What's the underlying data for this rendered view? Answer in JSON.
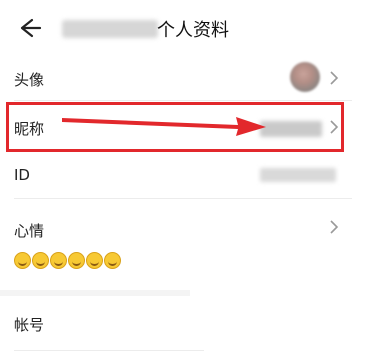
{
  "header": {
    "title": "个人资料",
    "back_icon": "arrow-left-icon"
  },
  "rows": {
    "avatar": {
      "label": "头像"
    },
    "nickname": {
      "label": "昵称"
    },
    "id": {
      "label": "ID"
    },
    "mood": {
      "label": "心情",
      "emoji_count": 6
    },
    "account": {
      "label": "帐号"
    }
  },
  "colors": {
    "highlight": "#e2282c",
    "text": "#222222",
    "chevron": "#9a9a9a"
  }
}
